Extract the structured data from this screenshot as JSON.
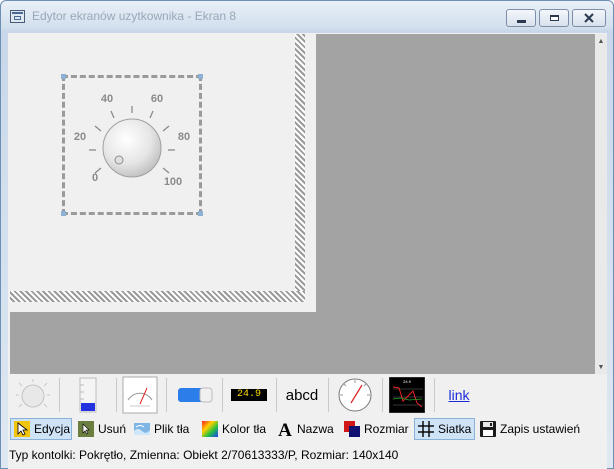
{
  "window": {
    "title": "Edytor ekranów uzytkownika - Ekran 8"
  },
  "knob": {
    "tick_labels": [
      "0",
      "20",
      "40",
      "60",
      "80",
      "100"
    ]
  },
  "toolbox": {
    "display_value": "24.9",
    "text_sample": "abcd",
    "link_sample": "link",
    "chart_title": "24.9"
  },
  "actions": [
    {
      "label": "Edycja",
      "icon": "cursor-icon",
      "selected": true
    },
    {
      "label": "Usuń",
      "icon": "delete-icon",
      "selected": false
    },
    {
      "label": "Plik tła",
      "icon": "background-file-icon",
      "selected": false
    },
    {
      "label": "Kolor tła",
      "icon": "color-palette-icon",
      "selected": false
    },
    {
      "label": "Nazwa",
      "icon": "font-a-icon",
      "selected": false
    },
    {
      "label": "Rozmiar",
      "icon": "resize-icon",
      "selected": false
    },
    {
      "label": "Siatka",
      "icon": "grid-icon",
      "selected": true
    },
    {
      "label": "Zapis ustawień",
      "icon": "floppy-disk-icon",
      "selected": false
    }
  ],
  "status": {
    "text": "Typ kontolki: Pokrętło, Zmienna: Obiekt 2/70613333/P, Rozmiar: 140x140"
  },
  "colors": {
    "canvas": "#a3a3a3",
    "selection": "#cfe3f7",
    "display_text": "#ffd800"
  }
}
